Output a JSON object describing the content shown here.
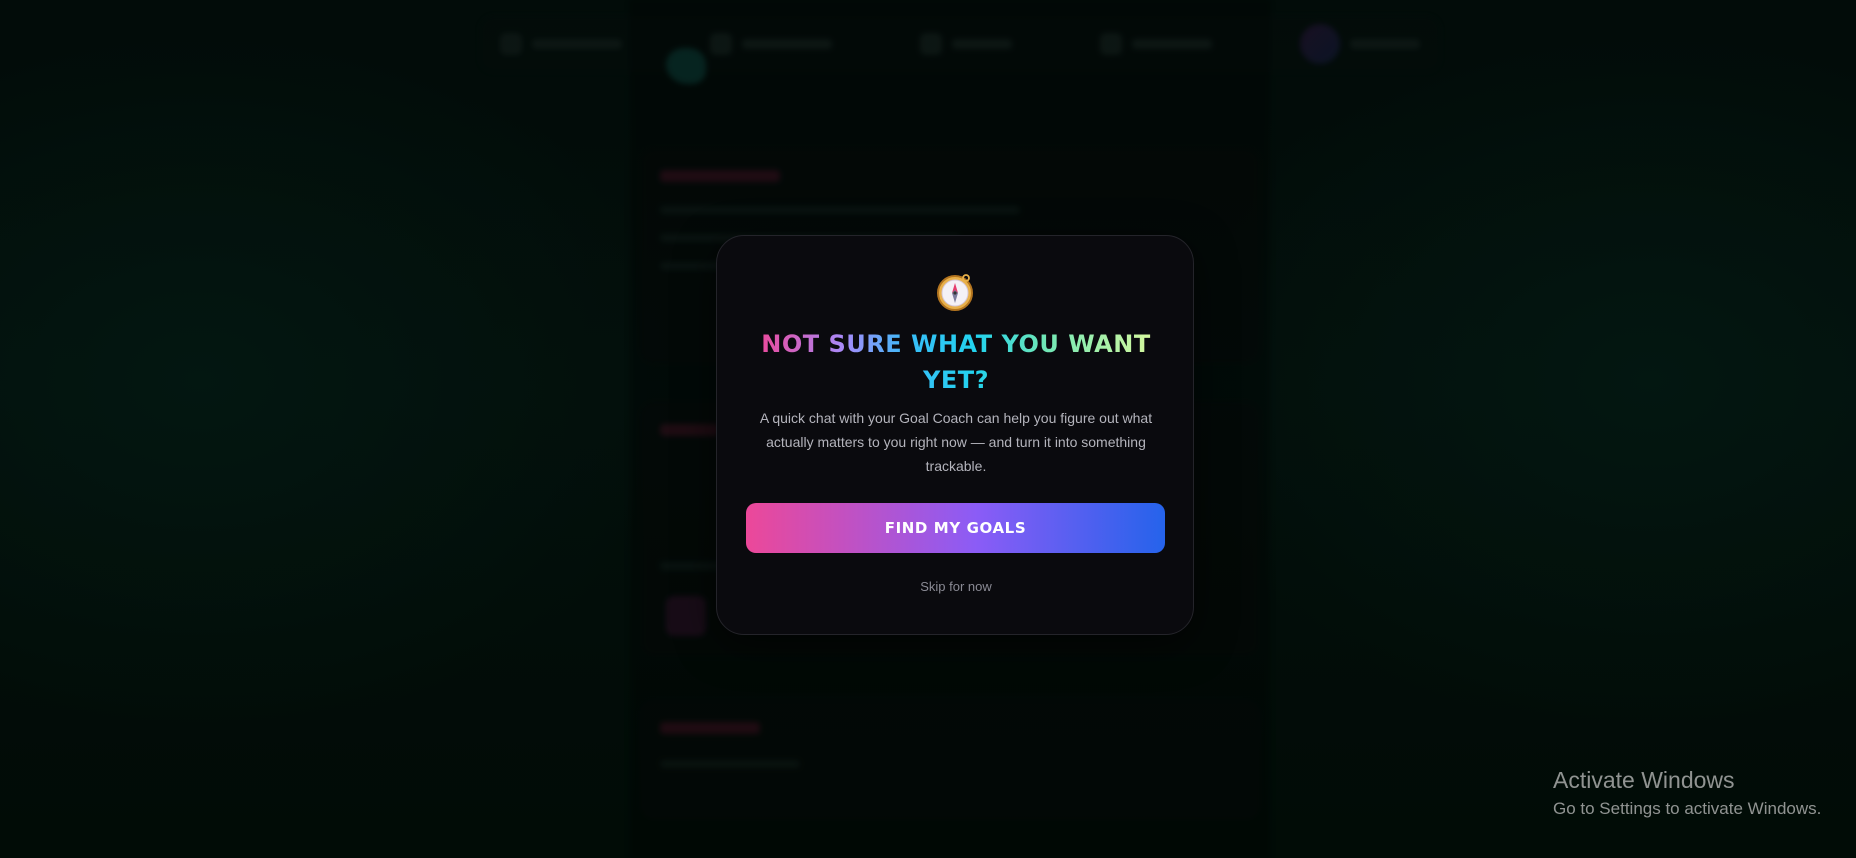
{
  "modal": {
    "icon": "compass-icon",
    "title": "NOT SURE WHAT YOU WANT YET?",
    "description": "A quick chat with your Goal Coach can help you figure out what actually matters to you right now — and turn it into something trackable.",
    "primary_button": "FIND MY GOALS",
    "skip_link": "Skip for now"
  },
  "watermark": {
    "title": "Activate Windows",
    "subtitle": "Go to Settings to activate Windows."
  },
  "colors": {
    "accent_pink": "#ec4899",
    "accent_blue": "#2563eb",
    "modal_bg": "#0a0a0e"
  }
}
